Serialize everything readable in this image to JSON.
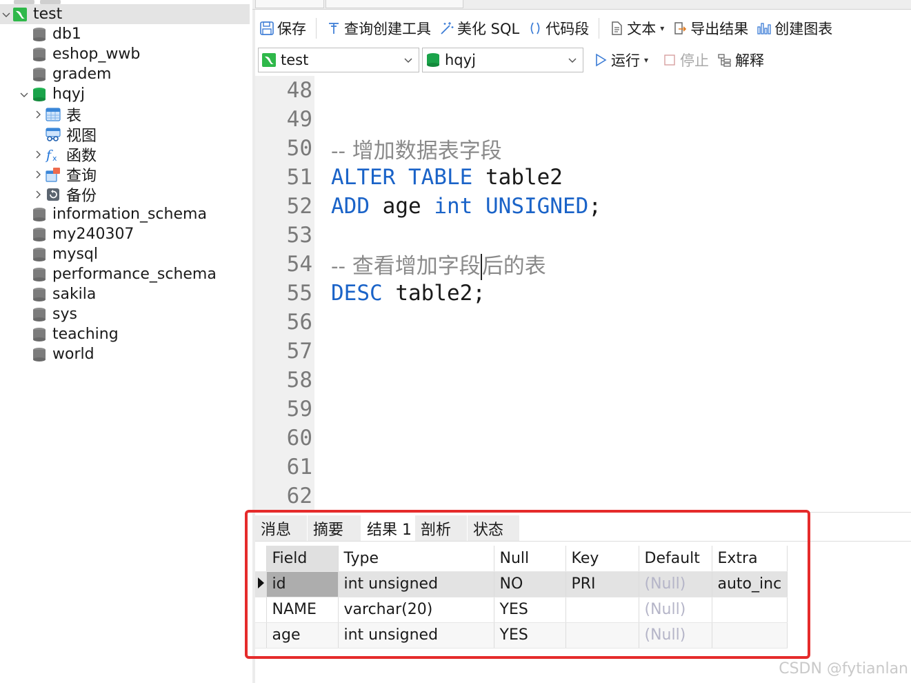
{
  "sidebar": {
    "items": [
      {
        "label": "test",
        "level": 0,
        "expanded": true,
        "icon": "connection-icon",
        "selected": true
      },
      {
        "label": "db1",
        "level": 1,
        "icon": "database-gray-icon"
      },
      {
        "label": "eshop_wwb",
        "level": 1,
        "icon": "database-gray-icon"
      },
      {
        "label": "gradem",
        "level": 1,
        "icon": "database-gray-icon"
      },
      {
        "label": "hqyj",
        "level": 1,
        "expanded": true,
        "icon": "database-green-icon"
      },
      {
        "label": "表",
        "level": 2,
        "collapsed": true,
        "icon": "table-icon"
      },
      {
        "label": "视图",
        "level": 2,
        "icon": "view-icon"
      },
      {
        "label": "函数",
        "level": 2,
        "collapsed": true,
        "icon": "function-icon"
      },
      {
        "label": "查询",
        "level": 2,
        "collapsed": true,
        "icon": "query-icon"
      },
      {
        "label": "备份",
        "level": 2,
        "collapsed": true,
        "icon": "backup-icon"
      },
      {
        "label": "information_schema",
        "level": 1,
        "icon": "database-gray-icon"
      },
      {
        "label": "my240307",
        "level": 1,
        "icon": "database-gray-icon"
      },
      {
        "label": "mysql",
        "level": 1,
        "icon": "database-gray-icon"
      },
      {
        "label": "performance_schema",
        "level": 1,
        "icon": "database-gray-icon"
      },
      {
        "label": "sakila",
        "level": 1,
        "icon": "database-gray-icon"
      },
      {
        "label": "sys",
        "level": 1,
        "icon": "database-gray-icon"
      },
      {
        "label": "teaching",
        "level": 1,
        "icon": "database-gray-icon"
      },
      {
        "label": "world",
        "level": 1,
        "icon": "database-gray-icon"
      }
    ]
  },
  "toolbar": {
    "save": "保存",
    "query_builder": "查询创建工具",
    "beautify_sql": "美化 SQL",
    "code_snippet": "代码段",
    "text": "文本",
    "export_result": "导出结果",
    "create_chart": "创建图表"
  },
  "toolbar2": {
    "connection": "test",
    "database": "hqyj",
    "run": "运行",
    "stop": "停止",
    "explain": "解释"
  },
  "editor": {
    "lines": [
      {
        "n": "48",
        "tokens": []
      },
      {
        "n": "49",
        "tokens": []
      },
      {
        "n": "50",
        "tokens": [
          {
            "t": "-- 增加数据表字段",
            "c": "cm"
          }
        ]
      },
      {
        "n": "51",
        "tokens": [
          {
            "t": "ALTER TABLE",
            "c": "kw"
          },
          {
            "t": " table2",
            "c": "id"
          }
        ]
      },
      {
        "n": "52",
        "tokens": [
          {
            "t": "ADD",
            "c": "kw"
          },
          {
            "t": " age ",
            "c": "id"
          },
          {
            "t": "int",
            "c": "kw"
          },
          {
            "t": " ",
            "c": "id"
          },
          {
            "t": "UNSIGNED",
            "c": "kw"
          },
          {
            "t": ";",
            "c": "id"
          }
        ]
      },
      {
        "n": "53",
        "tokens": []
      },
      {
        "n": "54",
        "tokens": [
          {
            "t": "-- 查看增加字段",
            "c": "cm"
          },
          {
            "t": "",
            "c": "cursor"
          },
          {
            "t": "后的表",
            "c": "cm"
          }
        ]
      },
      {
        "n": "55",
        "tokens": [
          {
            "t": "DESC",
            "c": "kw"
          },
          {
            "t": " table2;",
            "c": "id"
          }
        ]
      },
      {
        "n": "56",
        "tokens": []
      },
      {
        "n": "57",
        "tokens": []
      },
      {
        "n": "58",
        "tokens": []
      },
      {
        "n": "59",
        "tokens": []
      },
      {
        "n": "60",
        "tokens": []
      },
      {
        "n": "61",
        "tokens": []
      },
      {
        "n": "62",
        "tokens": []
      }
    ]
  },
  "results": {
    "tabs": [
      "消息",
      "摘要",
      "结果 1",
      "剖析",
      "状态"
    ],
    "active_tab": 2,
    "columns": [
      "Field",
      "Type",
      "Null",
      "Key",
      "Default",
      "Extra"
    ],
    "rows": [
      [
        "id",
        "int unsigned",
        "NO",
        "PRI",
        "(Null)",
        "auto_inc"
      ],
      [
        "NAME",
        "varchar(20)",
        "YES",
        "",
        "(Null)",
        ""
      ],
      [
        "age",
        "int unsigned",
        "YES",
        "",
        "(Null)",
        ""
      ]
    ],
    "selected_row": 0
  },
  "colors": {
    "keyword": "#1a63c8",
    "comment": "#8a8a8a",
    "highlight_box": "#e52b2b",
    "db_active": "#1aa34a"
  },
  "watermark": "CSDN @fytianlan"
}
